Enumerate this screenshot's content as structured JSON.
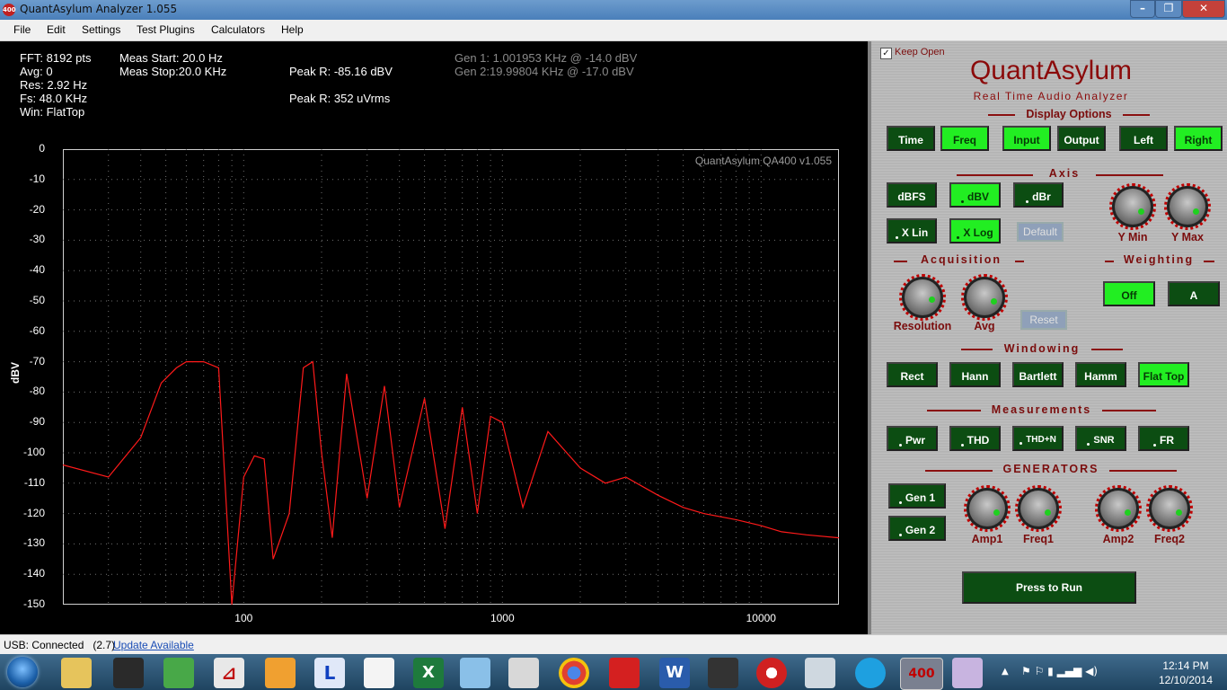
{
  "window": {
    "title": "QuantAsylum Analyzer 1.055",
    "app_icon_text": "400",
    "controls": [
      "–",
      "❐",
      "✕"
    ]
  },
  "menu": [
    "File",
    "Edit",
    "Settings",
    "Test Plugins",
    "Calculators",
    "Help"
  ],
  "info": {
    "col1": [
      "FFT: 8192 pts",
      "Avg: 0",
      "Res: 2.92 Hz",
      "Fs: 48.0 KHz",
      "Win: FlatTop"
    ],
    "col2": [
      "Meas Start: 20.0 Hz",
      "Meas Stop:20.0 KHz"
    ],
    "peak1": "Peak R: -85.16 dBV",
    "peak2": "Peak R: 352 uVrms",
    "gen1": "Gen 1: 1.001953 KHz @ -14.0  dBV",
    "gen2": "Gen 2:19.99804 KHz @ -17.0  dBV"
  },
  "plot": {
    "watermark": "QuantAsylum QA400 v1.055",
    "ylabel": "dBV",
    "yticks": [
      "0",
      "-10",
      "-20",
      "-30",
      "-40",
      "-50",
      "-60",
      "-70",
      "-80",
      "-90",
      "-100",
      "-110",
      "-120",
      "-130",
      "-140",
      "-150"
    ],
    "xticks": [
      "100",
      "1000",
      "10000"
    ],
    "trace_color": "#ff1a1a"
  },
  "chart_data": {
    "type": "line",
    "xlabel": "",
    "ylabel": "dBV",
    "ylim": [
      -150,
      0
    ],
    "xlim": [
      20,
      20000
    ],
    "xscale": "log",
    "grid": true,
    "series": [
      {
        "x": [
          20,
          30,
          40,
          48,
          55,
          60,
          70,
          80,
          90,
          100,
          110,
          120,
          130,
          150,
          170,
          185,
          200,
          220,
          250,
          300,
          350,
          400,
          500,
          600,
          700,
          800,
          900,
          1000,
          1200,
          1500,
          2000,
          2500,
          3000,
          4000,
          5000,
          6000,
          8000,
          10000,
          12000,
          15000,
          20000
        ],
        "y": [
          -104,
          -108,
          -95,
          -77,
          -72,
          -70,
          -70,
          -72,
          -150,
          -108,
          -101,
          -102,
          -135,
          -120,
          -72,
          -70,
          -100,
          -128,
          -74,
          -115,
          -78,
          -118,
          -82,
          -125,
          -85,
          -120,
          -88,
          -90,
          -118,
          -93,
          -105,
          -110,
          -108,
          -114,
          -118,
          -120,
          -122,
          -124,
          -126,
          -127,
          -128
        ]
      }
    ]
  },
  "panel": {
    "keep_open": "Keep Open",
    "brand": "QuantAsylum",
    "tagline": "Real Time Audio Analyzer",
    "sections": {
      "display": "Display Options",
      "axis": "Axis",
      "acquisition": "Acquisition",
      "weighting": "Weighting",
      "windowing": "Windowing",
      "measurements": "Measurements",
      "generators": "GENERATORS"
    },
    "display_buttons": [
      "Time",
      "Freq",
      "Input",
      "Output",
      "Left",
      "Right"
    ],
    "axis_buttons": [
      "dBFS",
      "dBV",
      "dBr",
      "X Lin",
      "X Log",
      "Default"
    ],
    "axis_knobs": [
      "Y Min",
      "Y Max"
    ],
    "acq_knobs": [
      "Resolution",
      "Avg"
    ],
    "acq_reset": "Reset",
    "weighting_buttons": [
      "Off",
      "A"
    ],
    "window_buttons": [
      "Rect",
      "Hann",
      "Bartlett",
      "Hamm",
      "Flat Top"
    ],
    "measure_buttons": [
      "Pwr",
      "THD",
      "THD+N",
      "SNR",
      "FR"
    ],
    "gen_buttons": [
      "Gen 1",
      "Gen 2"
    ],
    "gen_knobs": [
      "Amp1",
      "Freq1",
      "Amp2",
      "Freq2"
    ],
    "run": "Press to Run"
  },
  "status": {
    "usb": "USB: Connected   (2.7)",
    "update": "Update Available"
  },
  "taskbar": {
    "time": "12:14 PM",
    "date": "12/10/2014",
    "excel_letter": "X",
    "word_letter": "W",
    "qa_badge": "400"
  }
}
